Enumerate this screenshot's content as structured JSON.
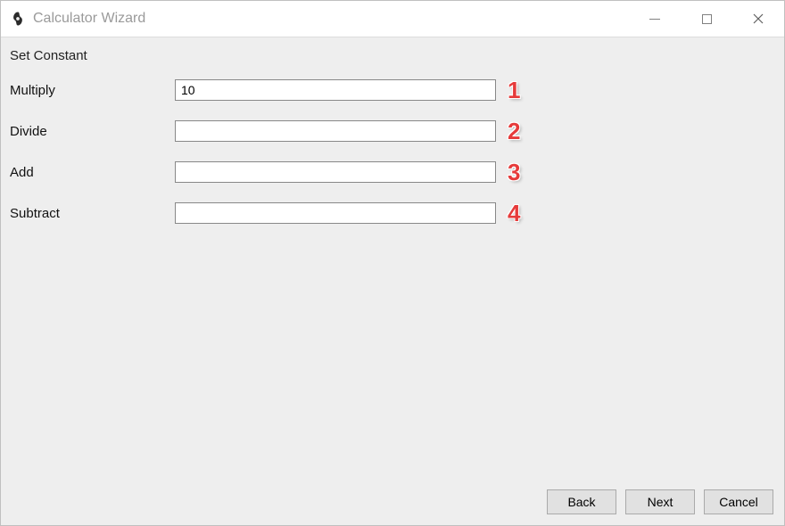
{
  "window": {
    "title": "Calculator Wizard"
  },
  "section": {
    "heading": "Set Constant"
  },
  "fields": [
    {
      "label": "Multiply",
      "value": "10",
      "annotation": "1"
    },
    {
      "label": "Divide",
      "value": "",
      "annotation": "2"
    },
    {
      "label": "Add",
      "value": "",
      "annotation": "3"
    },
    {
      "label": "Subtract",
      "value": "",
      "annotation": "4"
    }
  ],
  "buttons": {
    "back": "Back",
    "next": "Next",
    "cancel": "Cancel"
  }
}
